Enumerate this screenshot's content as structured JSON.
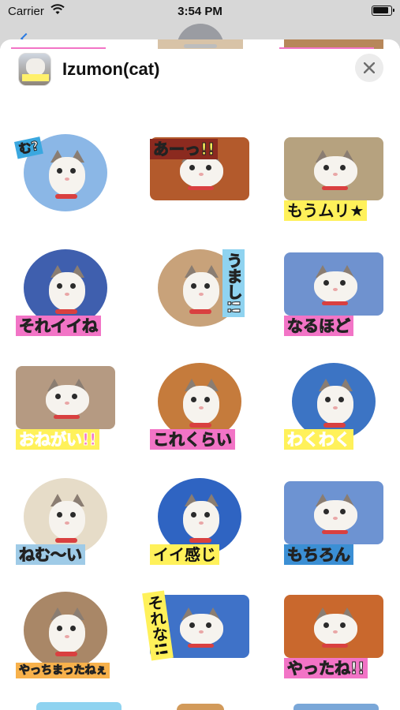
{
  "status_bar": {
    "carrier": "Carrier",
    "time": "3:54 PM"
  },
  "header": {
    "title": "Izumon(cat)"
  },
  "colors": {
    "yellow": "#fff15a",
    "pink": "#f274c6",
    "blue": "#3b8fd4",
    "light_blue": "#8fd3f0",
    "orange": "#f7b14b"
  },
  "stickers": [
    {
      "caption": "む?",
      "caption_bg": "#3aa7df",
      "photo_bg": "#8bb7e6",
      "shape": "circle",
      "caption_style": "tilt"
    },
    {
      "caption": "あーっ!!",
      "caption_bg": "#8b2a1f",
      "photo_bg": "#b35a2c",
      "shape": "square",
      "caption_style": "top"
    },
    {
      "caption": "もうムリ★",
      "caption_bg": "#fff15a",
      "photo_bg": "#b6a27f",
      "shape": "square",
      "caption_style": "dark"
    },
    {
      "caption": "それイイね",
      "caption_bg": "#f274c6",
      "photo_bg": "#3f5fae",
      "shape": "circle",
      "caption_style": "normal"
    },
    {
      "caption": "うまし!!",
      "caption_bg": "#8fd3f0",
      "photo_bg": "#c8a27a",
      "shape": "circle",
      "caption_style": "vertical"
    },
    {
      "caption": "なるほど",
      "caption_bg": "#f274c6",
      "photo_bg": "#6f92cf",
      "shape": "square",
      "caption_style": "normal"
    },
    {
      "caption": "おねがい!!",
      "caption_bg": "#fff15a",
      "photo_bg": "#b59a82",
      "shape": "square",
      "caption_style": "pinktext"
    },
    {
      "caption": "これくらい",
      "caption_bg": "#f274c6",
      "photo_bg": "#c57b3c",
      "shape": "circle",
      "caption_style": "normal"
    },
    {
      "caption": "わくわく",
      "caption_bg": "#fff15a",
      "photo_bg": "#3c74c4",
      "shape": "circle",
      "caption_style": "pinktext"
    },
    {
      "caption": "ねむ〜い",
      "caption_bg": "#9fcbe7",
      "photo_bg": "#e6dcc8",
      "shape": "circle",
      "caption_style": "normal"
    },
    {
      "caption": "イイ感じ",
      "caption_bg": "#fff15a",
      "photo_bg": "#2f64c2",
      "shape": "circle",
      "caption_style": "dark"
    },
    {
      "caption": "もちろん",
      "caption_bg": "#3b8fd4",
      "photo_bg": "#6d93d2",
      "shape": "square",
      "caption_style": "normal"
    },
    {
      "caption": "やっちまったねぇ",
      "caption_bg": "#f7b14b",
      "photo_bg": "#a98767",
      "shape": "circle",
      "caption_style": "small"
    },
    {
      "caption": "それな!!",
      "caption_bg": "#fff15a",
      "photo_bg": "#3f72c8",
      "shape": "square",
      "caption_style": "vertical-left"
    },
    {
      "caption": "やったね!!",
      "caption_bg": "#f274c6",
      "photo_bg": "#c9682d",
      "shape": "square",
      "caption_style": "normal"
    }
  ]
}
